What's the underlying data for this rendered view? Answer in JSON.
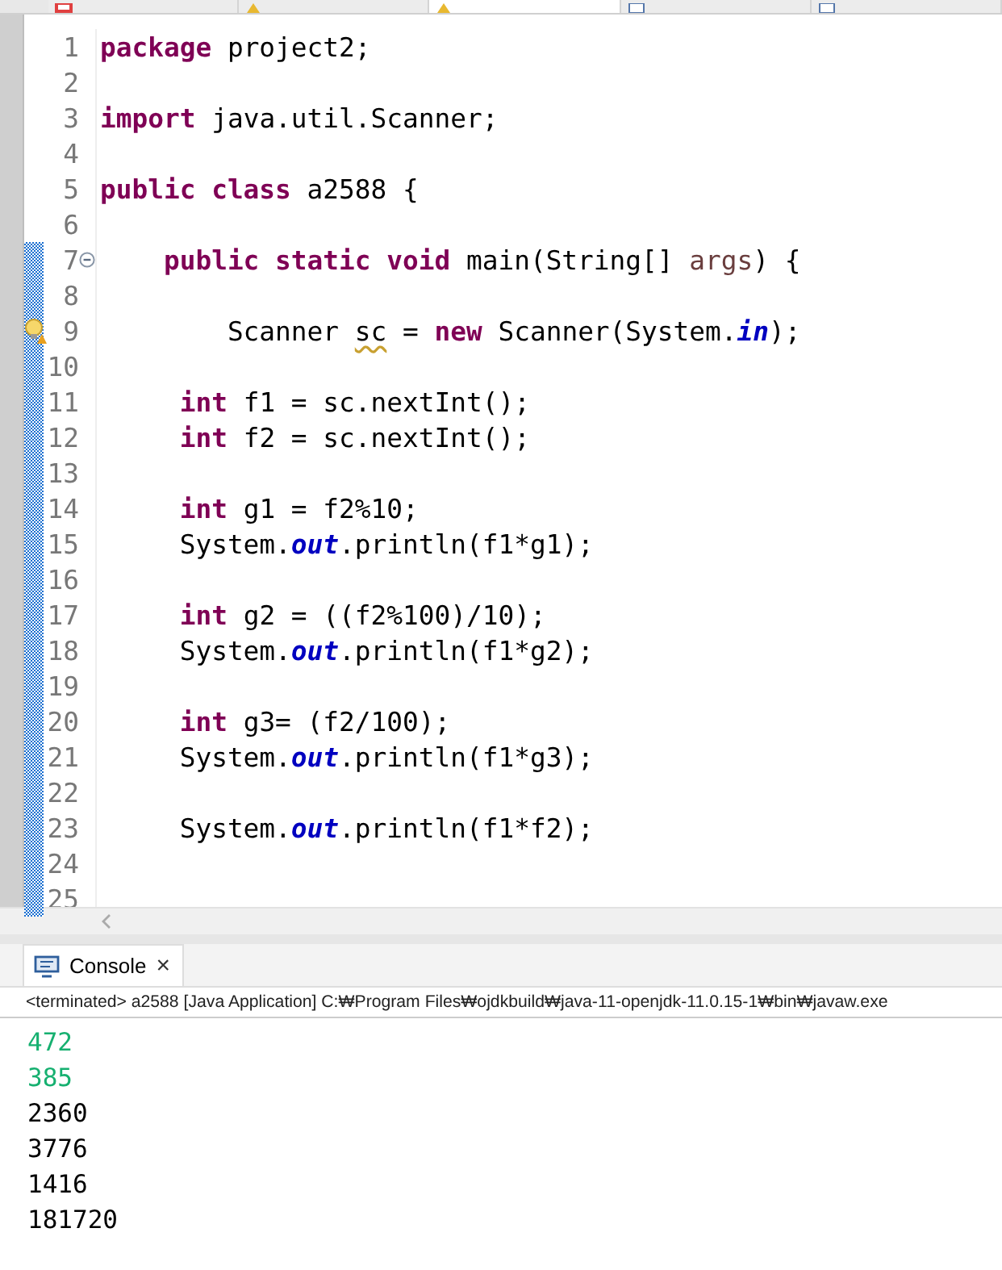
{
  "editor_tabs": [
    {
      "kind": "error",
      "selected": false
    },
    {
      "kind": "warning",
      "selected": false
    },
    {
      "kind": "warning",
      "selected": true
    },
    {
      "kind": "file",
      "selected": false
    },
    {
      "kind": "file",
      "selected": false
    }
  ],
  "code_lines": [
    {
      "number": "1",
      "changed": false,
      "tokens": [
        {
          "kind": "keyword",
          "text": "package"
        },
        {
          "kind": "plain",
          "text": " project2;"
        }
      ]
    },
    {
      "number": "2",
      "changed": false
    },
    {
      "number": "3",
      "changed": false,
      "tokens": [
        {
          "kind": "keyword",
          "text": "import"
        },
        {
          "kind": "plain",
          "text": " java.util.Scanner;"
        }
      ]
    },
    {
      "number": "4",
      "changed": false
    },
    {
      "number": "5",
      "changed": false,
      "tokens": [
        {
          "kind": "keyword",
          "text": "public class"
        },
        {
          "kind": "plain",
          "text": " a2588 {"
        }
      ]
    },
    {
      "number": "6",
      "changed": false
    },
    {
      "number": "7",
      "changed": true,
      "kind": "fold",
      "tokens": [
        {
          "kind": "keyword",
          "text": "    public static void"
        },
        {
          "kind": "plain",
          "text": " main(String[] "
        },
        {
          "kind": "param",
          "text": "args"
        },
        {
          "kind": "plain",
          "text": ") {"
        }
      ]
    },
    {
      "number": "8",
      "changed": true
    },
    {
      "number": "9",
      "changed": true,
      "kind": "warning",
      "tokens": [
        {
          "kind": "plain",
          "text": "        Scanner "
        },
        {
          "kind": "warned",
          "text": "sc"
        },
        {
          "kind": "plain",
          "text": " = "
        },
        {
          "kind": "keyword",
          "text": "new"
        },
        {
          "kind": "plain",
          "text": " Scanner(System."
        },
        {
          "kind": "static",
          "text": "in"
        },
        {
          "kind": "plain",
          "text": ");"
        }
      ]
    },
    {
      "number": "10",
      "changed": true
    },
    {
      "number": "11",
      "changed": true,
      "tokens": [
        {
          "kind": "keyword",
          "text": "     int"
        },
        {
          "kind": "plain",
          "text": " f1 = sc.nextInt();"
        }
      ]
    },
    {
      "number": "12",
      "changed": true,
      "tokens": [
        {
          "kind": "keyword",
          "text": "     int"
        },
        {
          "kind": "plain",
          "text": " f2 = sc.nextInt();"
        }
      ]
    },
    {
      "number": "13",
      "changed": true
    },
    {
      "number": "14",
      "changed": true,
      "tokens": [
        {
          "kind": "keyword",
          "text": "     int"
        },
        {
          "kind": "plain",
          "text": " g1 = f2%10;"
        }
      ]
    },
    {
      "number": "15",
      "changed": true,
      "tokens": [
        {
          "kind": "plain",
          "text": "     System."
        },
        {
          "kind": "static",
          "text": "out"
        },
        {
          "kind": "plain",
          "text": ".println(f1*g1);"
        }
      ]
    },
    {
      "number": "16",
      "changed": true
    },
    {
      "number": "17",
      "changed": true,
      "tokens": [
        {
          "kind": "keyword",
          "text": "     int"
        },
        {
          "kind": "plain",
          "text": " g2 = ((f2%100)/10);"
        }
      ]
    },
    {
      "number": "18",
      "changed": true,
      "tokens": [
        {
          "kind": "plain",
          "text": "     System."
        },
        {
          "kind": "static",
          "text": "out"
        },
        {
          "kind": "plain",
          "text": ".println(f1*g2);"
        }
      ]
    },
    {
      "number": "19",
      "changed": true
    },
    {
      "number": "20",
      "changed": true,
      "tokens": [
        {
          "kind": "keyword",
          "text": "     int"
        },
        {
          "kind": "plain",
          "text": " g3= (f2/100);"
        }
      ]
    },
    {
      "number": "21",
      "changed": true,
      "tokens": [
        {
          "kind": "plain",
          "text": "     System."
        },
        {
          "kind": "static",
          "text": "out"
        },
        {
          "kind": "plain",
          "text": ".println(f1*g3);"
        }
      ]
    },
    {
      "number": "22",
      "changed": true
    },
    {
      "number": "23",
      "changed": true,
      "tokens": [
        {
          "kind": "plain",
          "text": "     System."
        },
        {
          "kind": "static",
          "text": "out"
        },
        {
          "kind": "plain",
          "text": ".println(f1*f2);"
        }
      ]
    },
    {
      "number": "24",
      "changed": true
    },
    {
      "number": "25",
      "changed": true
    }
  ],
  "console": {
    "tab_label": "Console",
    "close": "×",
    "status": "<terminated> a2588 [Java Application] C:₩Program Files₩ojdkbuild₩java-11-openjdk-11.0.15-1₩bin₩javaw.exe",
    "lines": [
      {
        "kind": "input",
        "text": "472"
      },
      {
        "kind": "input",
        "text": "385"
      },
      {
        "kind": "output",
        "text": "2360"
      },
      {
        "kind": "output",
        "text": "3776"
      },
      {
        "kind": "output",
        "text": "1416"
      },
      {
        "kind": "output",
        "text": "181720"
      }
    ]
  }
}
